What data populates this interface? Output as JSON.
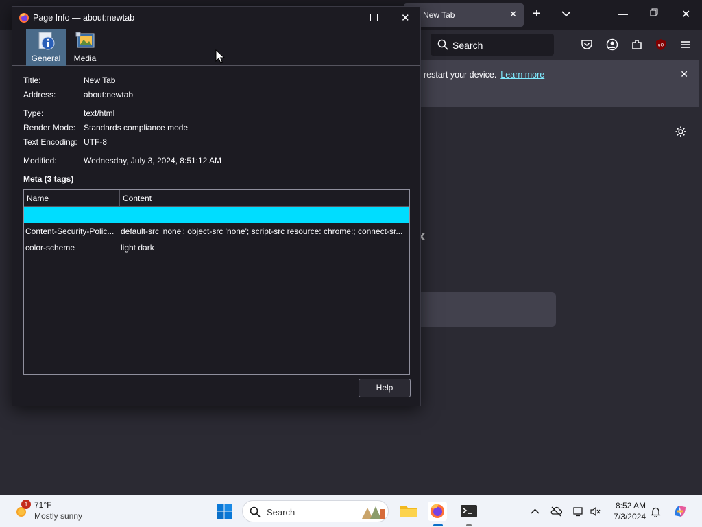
{
  "firefox": {
    "tab_title": "New Tab",
    "search_placeholder": "Search",
    "notice_text": "restart your device.",
    "notice_link": "Learn more",
    "arrow_glyph": "‹",
    "colors": {
      "tabstrip": "#1c1b22",
      "toolbar": "#2b2a33",
      "accent_link": "#80ebff"
    }
  },
  "dialog": {
    "title": "Page Info — about:newtab",
    "toolbar": [
      {
        "label": "General",
        "icon": "info-icon",
        "selected": true
      },
      {
        "label": "Media",
        "icon": "media-icon",
        "selected": false
      }
    ],
    "general": {
      "title_label": "Title:",
      "title_value": "New Tab",
      "address_label": "Address:",
      "address_value": "about:newtab",
      "type_label": "Type:",
      "type_value": "text/html",
      "render_label": "Render Mode:",
      "render_value": "Standards compliance mode",
      "encoding_label": "Text Encoding:",
      "encoding_value": "UTF-8",
      "modified_label": "Modified:",
      "modified_value": "Wednesday, July 3, 2024, 8:51:12 AM"
    },
    "meta": {
      "heading": "Meta (3 tags)",
      "columns": {
        "name": "Name",
        "content": "Content"
      },
      "rows": [
        {
          "name": "",
          "content": "",
          "selected": true
        },
        {
          "name": "Content-Security-Polic...",
          "content": "default-src 'none'; object-src 'none'; script-src resource: chrome:; connect-sr..."
        },
        {
          "name": "color-scheme",
          "content": "light dark"
        }
      ]
    },
    "help_label": "Help",
    "colors": {
      "selected_row": "#00ddff",
      "selected_tab": "#4a6b8a"
    }
  },
  "taskbar": {
    "weather_badge": "1",
    "weather_temp": "71°F",
    "weather_desc": "Mostly sunny",
    "search_placeholder": "Search",
    "apps": [
      {
        "name": "file-explorer-icon"
      },
      {
        "name": "firefox-icon",
        "active": true
      },
      {
        "name": "terminal-icon"
      }
    ],
    "time": "8:52 AM",
    "date": "7/3/2024"
  }
}
